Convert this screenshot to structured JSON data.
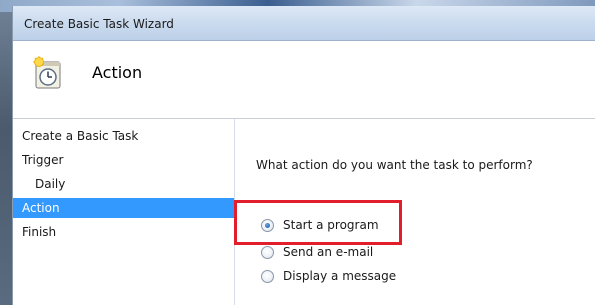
{
  "window": {
    "title": "Create Basic Task Wizard"
  },
  "header": {
    "title": "Action",
    "icon": "task-scheduler-icon"
  },
  "sidebar": {
    "items": [
      {
        "label": "Create a Basic Task",
        "active": false
      },
      {
        "label": "Trigger",
        "active": false
      },
      {
        "label": "Daily",
        "active": false,
        "sub": true
      },
      {
        "label": "Action",
        "active": true
      },
      {
        "label": "Finish",
        "active": false
      }
    ]
  },
  "main": {
    "question": "What action do you want the task to perform?",
    "options": [
      {
        "label": "Start a program",
        "selected": true
      },
      {
        "label": "Send an e-mail",
        "selected": false
      },
      {
        "label": "Display a message",
        "selected": false
      }
    ]
  },
  "colors": {
    "active_item": "#3399ff",
    "highlight_box": "#e21d2c"
  }
}
